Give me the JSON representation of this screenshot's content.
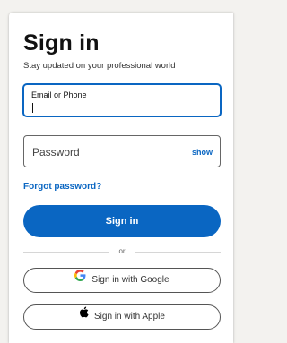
{
  "title": "Sign in",
  "subtitle": "Stay updated on your professional world",
  "email": {
    "label": "Email or Phone",
    "value": ""
  },
  "password": {
    "placeholder": "Password",
    "show_label": "show"
  },
  "forgot_label": "Forgot password?",
  "signin_label": "Sign in",
  "divider_label": "or",
  "google_label": "Sign in with Google",
  "apple_label": "Sign in with Apple",
  "colors": {
    "accent": "#0a66c2",
    "background": "#f3f2ef"
  },
  "icons": {
    "google": "google-logo",
    "apple": "apple-logo"
  }
}
